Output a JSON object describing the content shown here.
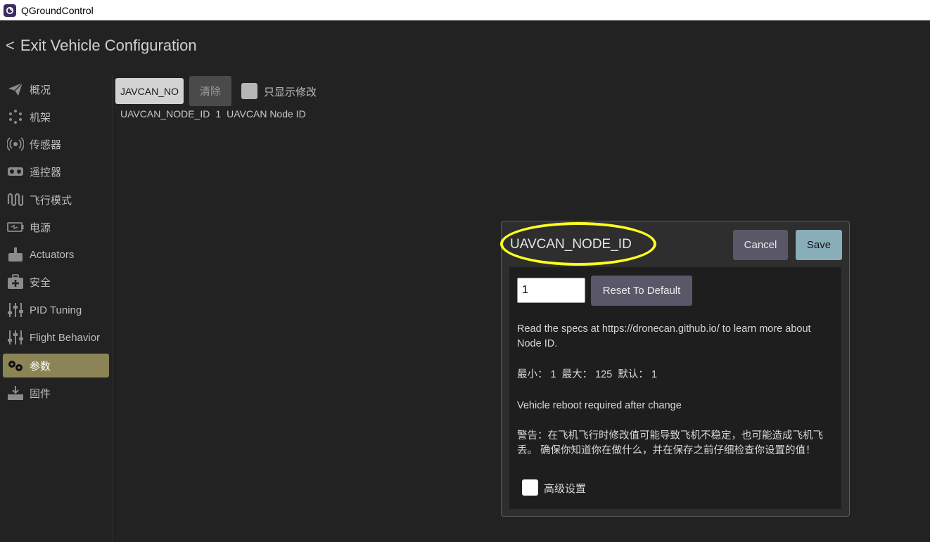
{
  "window": {
    "title": "QGroundControl"
  },
  "exit": {
    "label": "Exit Vehicle Configuration",
    "chevron": "<"
  },
  "sidebar": {
    "items": [
      {
        "label": "概况",
        "icon": "paper-plane-icon"
      },
      {
        "label": "机架",
        "icon": "dots-circle-icon"
      },
      {
        "label": "传感器",
        "icon": "radio-waves-icon"
      },
      {
        "label": "遥控器",
        "icon": "remote-control-icon"
      },
      {
        "label": "飞行模式",
        "icon": "waveform-icon"
      },
      {
        "label": "电源",
        "icon": "battery-icon"
      },
      {
        "label": "Actuators",
        "icon": "actuator-icon"
      },
      {
        "label": "安全",
        "icon": "first-aid-icon"
      },
      {
        "label": "PID Tuning",
        "icon": "sliders-icon"
      },
      {
        "label": "Flight Behavior",
        "icon": "sliders-icon"
      },
      {
        "label": "参数",
        "icon": "gears-icon",
        "active": true
      },
      {
        "label": "固件",
        "icon": "download-icon"
      }
    ]
  },
  "search": {
    "value": "JAVCAN_NO"
  },
  "toolbar": {
    "clear_label": "清除",
    "modified_only_label": "只显示修改"
  },
  "param_row": {
    "name": "UAVCAN_NODE_ID",
    "value": "1",
    "description": "UAVCAN Node ID"
  },
  "dialog": {
    "title": "UAVCAN_NODE_ID",
    "cancel_label": "Cancel",
    "save_label": "Save",
    "value": "1",
    "reset_label": "Reset To Default",
    "help_text": "Read the specs at https://dronecan.github.io/ to learn more about Node ID.",
    "range_text": "最小： 1  最大： 125  默认： 1",
    "reboot_text": "Vehicle reboot required after change",
    "warning_text": "警告：在飞机飞行时修改值可能导致飞机不稳定，也可能造成飞机飞丢。 确保你知道你在做什么，并在保存之前仔细检查你设置的值！",
    "advanced_label": "高级设置"
  },
  "colors": {
    "highlight": "#ffff20",
    "active_nav": "#8a8456",
    "save_button": "#88aeb9"
  }
}
